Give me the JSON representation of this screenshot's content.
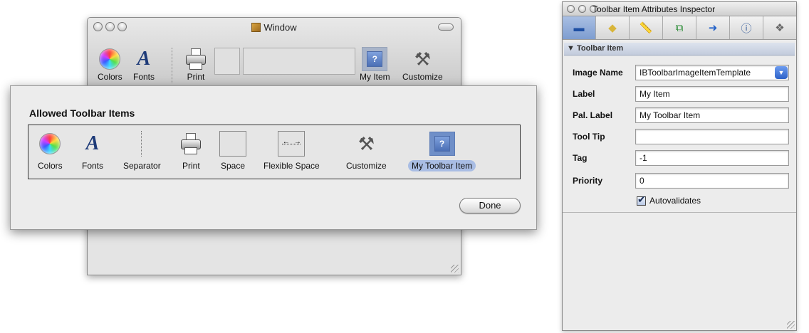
{
  "window": {
    "title": "Window",
    "toolbar": [
      {
        "label": "Colors",
        "icon": "color-wheel-icon"
      },
      {
        "label": "Fonts",
        "icon": "font-icon"
      },
      {
        "label": "Print",
        "icon": "printer-icon"
      },
      {
        "label": "My Item",
        "icon": "my-item-icon"
      },
      {
        "label": "Customize",
        "icon": "tools-icon"
      }
    ]
  },
  "sheet": {
    "heading": "Allowed Toolbar Items",
    "items": [
      {
        "label": "Colors",
        "icon": "color-wheel-icon"
      },
      {
        "label": "Fonts",
        "icon": "font-icon"
      },
      {
        "label": "Separator",
        "icon": "separator-icon"
      },
      {
        "label": "Print",
        "icon": "printer-icon"
      },
      {
        "label": "Space",
        "icon": "space-icon"
      },
      {
        "label": "Flexible Space",
        "icon": "flexible-space-icon"
      },
      {
        "label": "Customize",
        "icon": "tools-icon"
      },
      {
        "label": "My Toolbar Item",
        "icon": "my-item-icon",
        "selected": true
      }
    ],
    "done_label": "Done"
  },
  "inspector": {
    "title": "Toolbar Item Attributes Inspector",
    "tabs": [
      {
        "icon": "attributes-icon",
        "active": true
      },
      {
        "icon": "effects-icon"
      },
      {
        "icon": "size-ruler-icon"
      },
      {
        "icon": "bindings-icon"
      },
      {
        "icon": "connections-icon"
      },
      {
        "icon": "info-icon"
      },
      {
        "icon": "identity-icon"
      }
    ],
    "section": "▼ Toolbar Item",
    "fields": {
      "image_name": {
        "label": "Image Name",
        "value": "IBToolbarImageItemTemplate"
      },
      "label": {
        "label": "Label",
        "value": "My Item"
      },
      "pal_label": {
        "label": "Pal. Label",
        "value": "My Toolbar Item"
      },
      "tool_tip": {
        "label": "Tool Tip",
        "value": ""
      },
      "tag": {
        "label": "Tag",
        "value": "-1"
      },
      "priority": {
        "label": "Priority",
        "value": "0"
      }
    },
    "autovalidates": {
      "label": "Autovalidates",
      "checked": true
    }
  },
  "colors": {
    "selection": "#a9bde4",
    "accent": "#3b6fd0"
  }
}
